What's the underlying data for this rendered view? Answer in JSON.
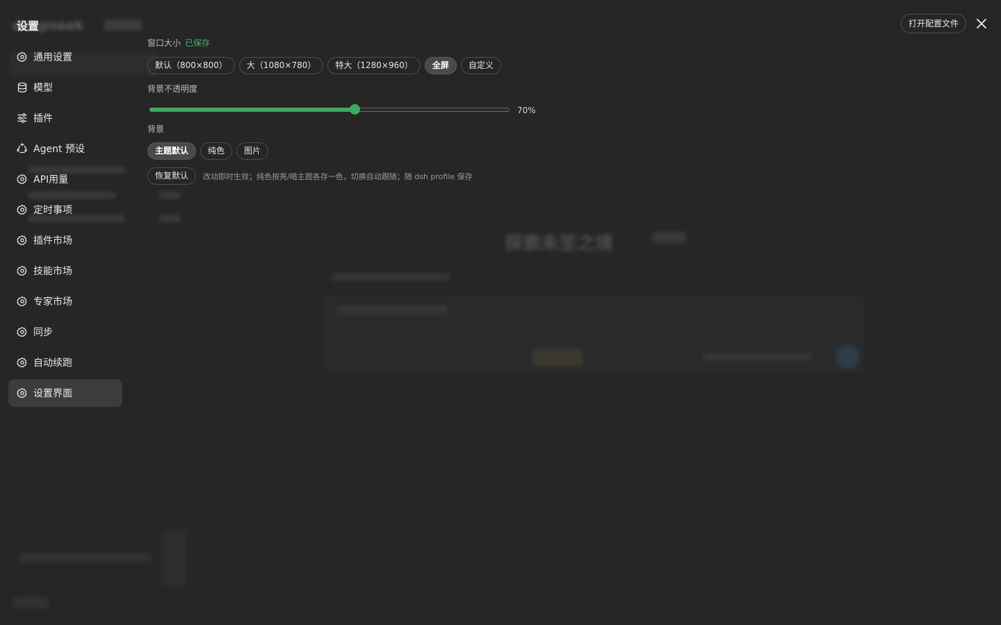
{
  "settings": {
    "title": "设置",
    "open_config_label": "打开配置文件",
    "nav": [
      {
        "label": "通用设置",
        "icon": "gear-icon"
      },
      {
        "label": "模型",
        "icon": "database-icon"
      },
      {
        "label": "插件",
        "icon": "sliders-icon"
      },
      {
        "label": "Agent 预设",
        "icon": "recycle-icon"
      },
      {
        "label": "API用量",
        "icon": "gear-icon"
      },
      {
        "label": "定时事项",
        "icon": "gear-icon"
      },
      {
        "label": "插件市场",
        "icon": "gear-icon"
      },
      {
        "label": "技能市场",
        "icon": "gear-icon"
      },
      {
        "label": "专家市场",
        "icon": "gear-icon"
      },
      {
        "label": "同步",
        "icon": "gear-icon"
      },
      {
        "label": "自动续跑",
        "icon": "gear-icon"
      },
      {
        "label": "设置界面",
        "icon": "gear-icon",
        "active": true
      }
    ],
    "window_size": {
      "label": "窗口大小",
      "status": "已保存",
      "options": [
        "默认（800×800）",
        "大（1080×780）",
        "特大（1280×960）",
        "全屏",
        "自定义"
      ],
      "selected": "全屏"
    },
    "opacity": {
      "label": "背景不透明度",
      "value": 70,
      "display": "70%"
    },
    "background": {
      "label": "背景",
      "options": [
        "主题默认",
        "纯色",
        "图片"
      ],
      "selected": "主题默认"
    },
    "reset": {
      "label": "恢复默认",
      "hint": "改动即时生效；纯色按亮/暗主题各存一色，切换自动跟随；随 dsh profile 保存"
    }
  },
  "background_app": {
    "logo": "deepseek",
    "hero": "探索未至之境"
  },
  "colors": {
    "accent_green": "#3dab5f",
    "saved_green": "#4caf6a",
    "background": "#262626",
    "active_nav": "#3c3c3e"
  }
}
